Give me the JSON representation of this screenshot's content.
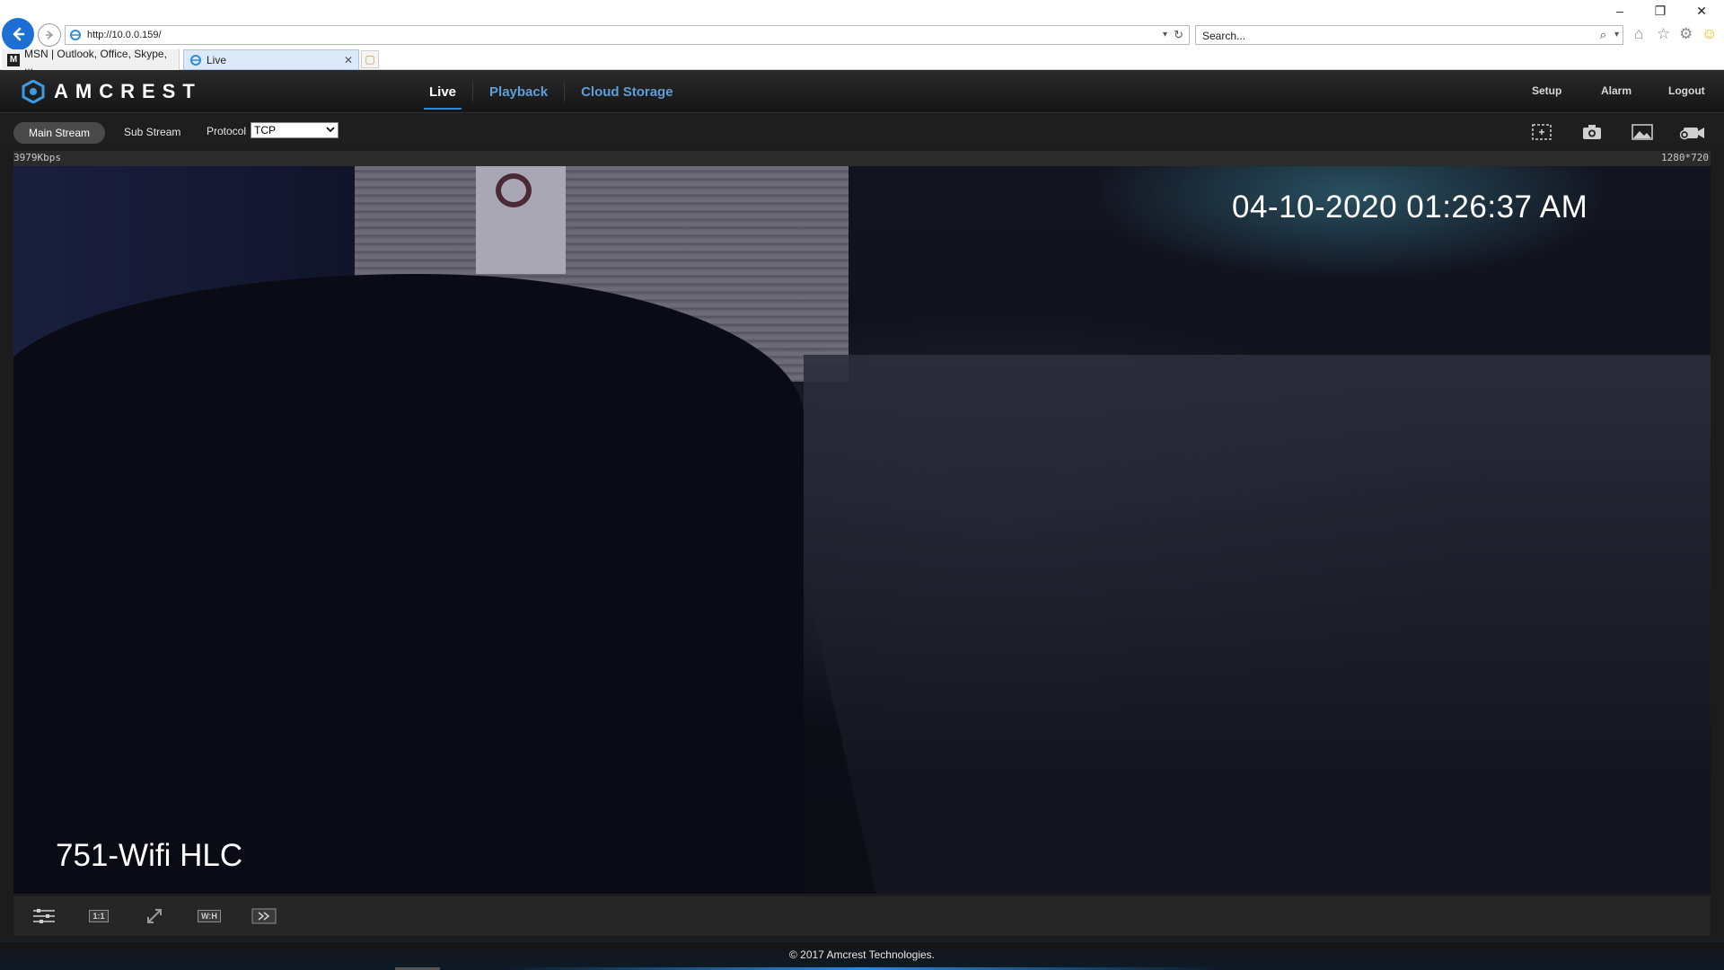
{
  "browser": {
    "address": "http://10.0.0.159/",
    "search_placeholder": "Search...",
    "tabs": [
      {
        "label": "MSN | Outlook, Office, Skype, ..."
      },
      {
        "label": "Live"
      }
    ]
  },
  "header": {
    "brand": "AMCREST",
    "nav": [
      {
        "label": "Live",
        "active": true
      },
      {
        "label": "Playback",
        "active": false
      },
      {
        "label": "Cloud Storage",
        "active": false
      }
    ],
    "right_links": {
      "setup": "Setup",
      "alarm": "Alarm",
      "logout": "Logout"
    }
  },
  "toolbar": {
    "main_stream": "Main Stream",
    "sub_stream": "Sub Stream",
    "protocol_label": "Protocol",
    "protocol_value": "TCP",
    "icons": [
      "zoom-region-icon",
      "snapshot-icon",
      "image-icon",
      "record-icon"
    ]
  },
  "video": {
    "bitrate": "3979Kbps",
    "resolution": "1280*720",
    "timestamp": "04-10-2020 01:26:37 AM",
    "camera_name": "751-Wifi HLC"
  },
  "controls": {
    "ratio_label": "1:1",
    "wh_label": "W:H"
  },
  "footer": {
    "copyright": "© 2017 Amcrest Technologies."
  },
  "colors": {
    "nav_inactive": "#5d9fd6",
    "nav_active": "#ffffff",
    "accent": "#2f86d6",
    "header_bg": "#1c1c1c"
  }
}
